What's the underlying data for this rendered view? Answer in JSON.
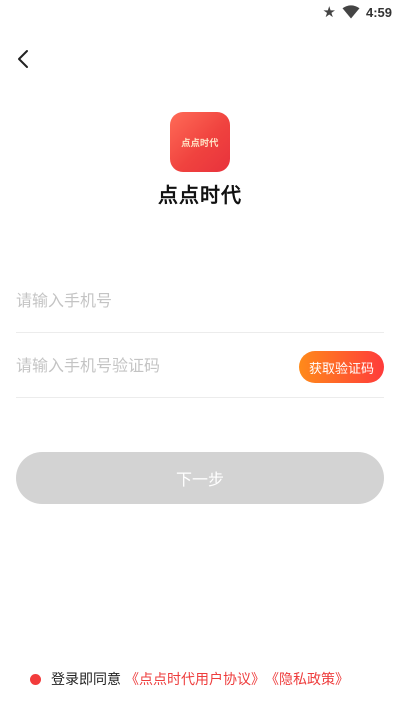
{
  "status_bar": {
    "time": "4:59",
    "icons": [
      "star-icon",
      "wifi-icon"
    ]
  },
  "header": {
    "back_icon": "chevron-left-icon"
  },
  "brand": {
    "logo_text": "点点时代",
    "app_name": "点点时代",
    "logo_color": "#f0433f"
  },
  "form": {
    "phone_placeholder": "请输入手机号",
    "phone_value": "",
    "code_placeholder": "请输入手机号验证码",
    "code_value": "",
    "get_code_label": "获取验证码",
    "next_label": "下一步"
  },
  "agreement": {
    "prefix": "登录即同意",
    "user_agreement": "《点点时代用户协议》",
    "privacy_policy": "《隐私政策》"
  },
  "colors": {
    "accent": "#f23b3b",
    "button_disabled": "#d3d3d3",
    "gradient_start": "#ff8a1a",
    "gradient_end": "#ff3b3b"
  }
}
